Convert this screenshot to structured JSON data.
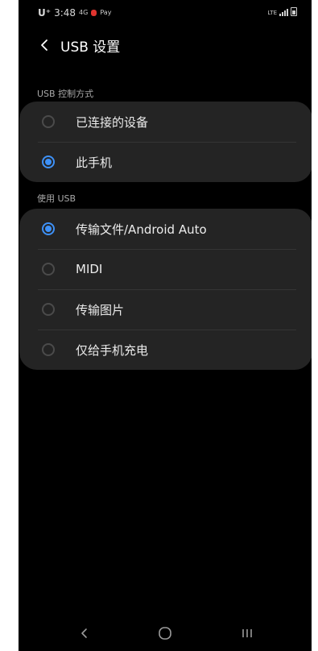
{
  "status_bar": {
    "carrier": "U⁺",
    "time": "3:48",
    "network_text": "4G",
    "pay_text": "Pay"
  },
  "header": {
    "back_icon": "chevron-left-icon",
    "title": "USB 设置"
  },
  "sections": [
    {
      "label": "USB 控制方式",
      "options": [
        {
          "label": "已连接的设备",
          "selected": false
        },
        {
          "label": "此手机",
          "selected": true
        }
      ]
    },
    {
      "label": "使用 USB",
      "options": [
        {
          "label": "传输文件/Android Auto",
          "selected": true
        },
        {
          "label": "MIDI",
          "selected": false
        },
        {
          "label": "传输图片",
          "selected": false
        },
        {
          "label": "仅给手机充电",
          "selected": false
        }
      ]
    }
  ],
  "nav_bar": {
    "back_icon": "back-chevron-icon",
    "home_icon": "home-circle-icon",
    "recents_icon": "recents-bars-icon"
  },
  "colors": {
    "accent": "#3e91f7",
    "card": "#242424",
    "background": "#000000"
  }
}
